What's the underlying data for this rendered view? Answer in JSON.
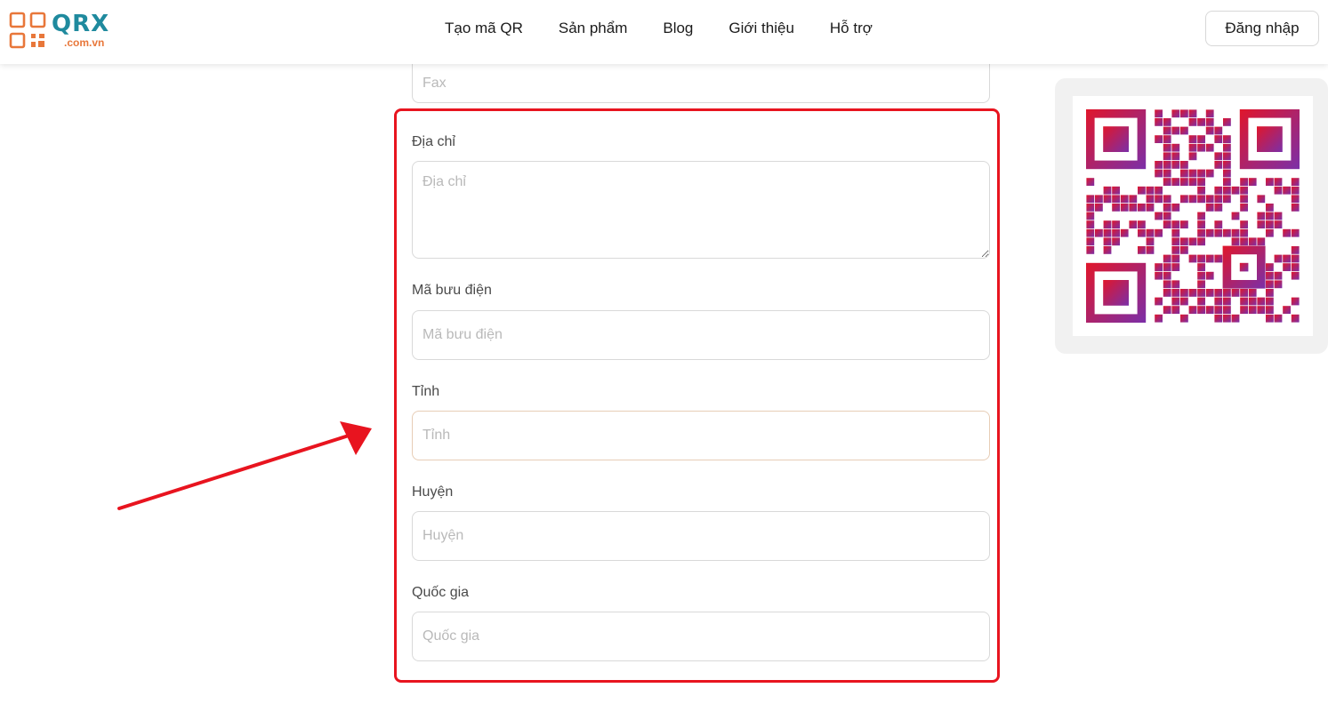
{
  "navbar": {
    "logo": {
      "word": "QRX",
      "domain": ".com.vn"
    },
    "links": [
      "Tạo mã QR",
      "Sản phẩm",
      "Blog",
      "Giới thiệu",
      "Hỗ trợ"
    ],
    "login_label": "Đăng nhập"
  },
  "form": {
    "fax": {
      "placeholder": "Fax"
    },
    "address": {
      "label": "Địa chỉ",
      "placeholder": "Địa chỉ"
    },
    "postal_code": {
      "label": "Mã bưu điện",
      "placeholder": "Mã bưu điện"
    },
    "province": {
      "label": "Tỉnh",
      "placeholder": "Tỉnh"
    },
    "district": {
      "label": "Huyện",
      "placeholder": "Huyện"
    },
    "country": {
      "label": "Quốc gia",
      "placeholder": "Quốc gia"
    }
  },
  "colors": {
    "highlight": "#e8141f",
    "brand_teal": "#1f8a9e",
    "brand_orange": "#e8773a",
    "qr_gradient_start": "#e0162b",
    "qr_gradient_end": "#7b2fa8"
  },
  "icons": {
    "logo": "qr-logo-icon",
    "annotation": "red-arrow-icon",
    "preview": "qr-code-icon"
  }
}
